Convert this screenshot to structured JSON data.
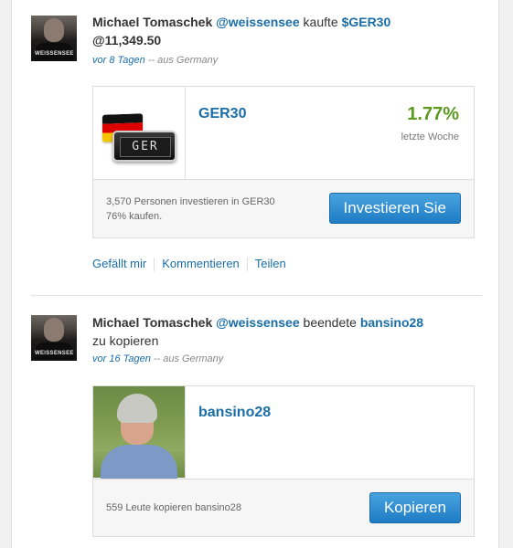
{
  "posts": [
    {
      "name": "Michael Tomaschek",
      "handle": "@weissensee",
      "verb": "kaufte",
      "asset": "$GER30",
      "detail": "@11,349.50",
      "ago": "vor 8 Tagen",
      "origin": " -- aus Germany",
      "card": {
        "title": "GER30",
        "percent": "1.77%",
        "period": "letzte Woche",
        "tile_text": "GER",
        "line1": "3,570 Personen investieren in GER30",
        "line2": "76% kaufen.",
        "button": "Investieren Sie"
      },
      "actions": [
        "Gefällt mir",
        "Kommentieren",
        "Teilen"
      ]
    },
    {
      "name": "Michael Tomaschek",
      "handle": "@weissensee",
      "verb": "beendete",
      "asset": "bansino28",
      "detail": "zu kopieren",
      "ago": "vor 16 Tagen",
      "origin": " -- aus Germany",
      "card": {
        "title": "bansino28",
        "line1": "559 Leute kopieren bansino28",
        "button": "Kopieren"
      }
    }
  ],
  "avatar_text": "WEISSENSEE",
  "colors": {
    "link": "#1a6ea8",
    "positive": "#5a9a1c",
    "button": "#2a86cf"
  }
}
